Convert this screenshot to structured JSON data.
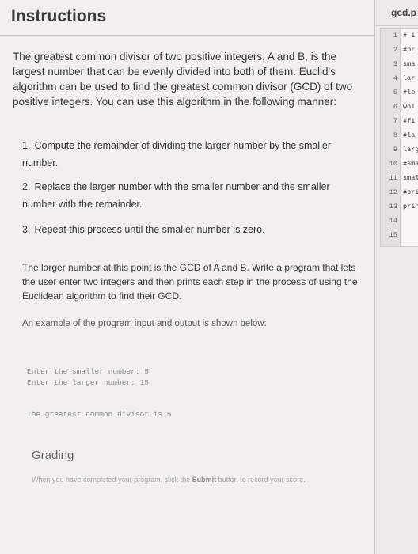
{
  "instructions": {
    "title": "Instructions",
    "intro": "The greatest common divisor of two positive integers, A and B, is the largest number that can be evenly divided into both of them. Euclid's algorithm can be used to find the greatest common divisor (GCD) of two positive integers. You can use this algorithm in the following manner:",
    "steps": [
      {
        "num": "1.",
        "text": "Compute the remainder of dividing the larger number by the smaller number."
      },
      {
        "num": "2.",
        "text": "Replace the larger number with the smaller number and the smaller number with the remainder."
      },
      {
        "num": "3.",
        "text": "Repeat this process until the smaller number is zero."
      }
    ],
    "para2": "The larger number at this point is the GCD of A and B. Write a program that lets the user enter two integers and then prints each step in the process of using the Euclidean algorithm to find their GCD.",
    "para3": "An example of the program input and output is shown below:",
    "sample": {
      "line1": "Enter the smaller number: 5",
      "line2": "Enter the larger number: 15",
      "line3": "The greatest common divisor is 5"
    },
    "grading": {
      "title": "Grading",
      "text_before": "When you have completed your program, click the ",
      "submit_word": "Submit",
      "text_after": " button to record your score."
    }
  },
  "editor": {
    "tab_label": "gcd.p",
    "lines": [
      {
        "num": "1",
        "code": "# i"
      },
      {
        "num": "2",
        "code": "#pr"
      },
      {
        "num": "3",
        "code": "sma"
      },
      {
        "num": "4",
        "code": "lar"
      },
      {
        "num": "5",
        "code": "#lo"
      },
      {
        "num": "6",
        "code": "whi"
      },
      {
        "num": "7",
        "code": "#fi"
      },
      {
        "num": "8",
        "code": "#la"
      },
      {
        "num": "9",
        "code": "larg"
      },
      {
        "num": "10",
        "code": "#sma"
      },
      {
        "num": "11",
        "code": "smal"
      },
      {
        "num": "12",
        "code": "#pri"
      },
      {
        "num": "13",
        "code": "prin"
      },
      {
        "num": "14",
        "code": ""
      },
      {
        "num": "15",
        "code": ""
      }
    ]
  }
}
